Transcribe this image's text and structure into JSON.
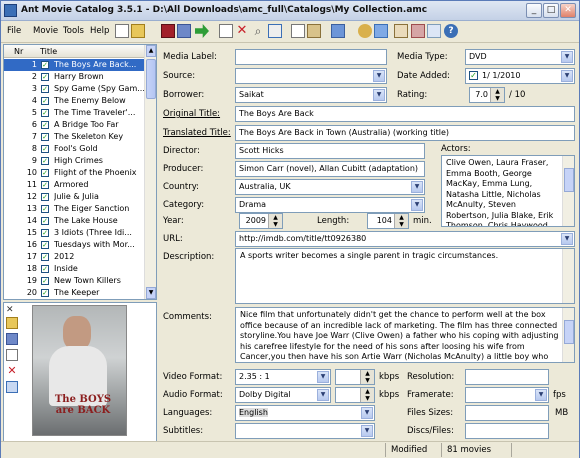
{
  "window": {
    "title": "Ant Movie Catalog 3.5.1 - D:\\All Downloads\\amc_full\\Catalogs\\My Collection.amc"
  },
  "menu": [
    "File",
    "Movie",
    "Tools",
    "Help"
  ],
  "list": {
    "col_nr": "Nr",
    "col_title": "Title",
    "rows": [
      {
        "nr": "1",
        "title": "The Boys Are Back..."
      },
      {
        "nr": "2",
        "title": "Harry Brown"
      },
      {
        "nr": "3",
        "title": "Spy Game (Spy Gam..."
      },
      {
        "nr": "4",
        "title": "The Enemy Below"
      },
      {
        "nr": "5",
        "title": "The Time Traveler'..."
      },
      {
        "nr": "6",
        "title": "A Bridge Too Far"
      },
      {
        "nr": "7",
        "title": "The Skeleton Key"
      },
      {
        "nr": "8",
        "title": "Fool's Gold"
      },
      {
        "nr": "9",
        "title": "High Crimes"
      },
      {
        "nr": "10",
        "title": "Flight of the Phoenix"
      },
      {
        "nr": "11",
        "title": "Armored"
      },
      {
        "nr": "12",
        "title": "Julie & Julia"
      },
      {
        "nr": "13",
        "title": "The Eiger Sanction"
      },
      {
        "nr": "14",
        "title": "The Lake House"
      },
      {
        "nr": "15",
        "title": "3 Idiots (Three Idi..."
      },
      {
        "nr": "16",
        "title": "Tuesdays with Mor..."
      },
      {
        "nr": "17",
        "title": "2012"
      },
      {
        "nr": "18",
        "title": "Inside"
      },
      {
        "nr": "19",
        "title": "New Town Killers"
      },
      {
        "nr": "20",
        "title": "The Keeper"
      }
    ]
  },
  "poster": {
    "text": "The BOYS are BACK"
  },
  "fields": {
    "media_label": {
      "label": "Media Label:",
      "value": ""
    },
    "media_type": {
      "label": "Media Type:",
      "value": "DVD"
    },
    "source": {
      "label": "Source:",
      "value": ""
    },
    "date_added": {
      "label": "Date Added:",
      "value": "1/  1/2010"
    },
    "borrower": {
      "label": "Borrower:",
      "value": "Saikat"
    },
    "rating": {
      "label": "Rating:",
      "value": "7.0",
      "suffix": "/ 10"
    },
    "original_title": {
      "label": "Original Title:",
      "value": "The Boys Are Back"
    },
    "translated_title": {
      "label": "Translated Title:",
      "value": "The Boys Are Back in Town (Australia) (working title)"
    },
    "director": {
      "label": "Director:",
      "value": "Scott Hicks"
    },
    "actors": {
      "label": "Actors:",
      "value": "Clive Owen, Laura Fraser, Emma Booth, George MacKay, Emma Lung, Natasha Little, Nicholas McAnulty, Steven Robertson, Julia Blake, Erik Thomson, Chris Haywood,"
    },
    "producer": {
      "label": "Producer:",
      "value": "Simon Carr (novel), Allan Cubitt (adaptation)"
    },
    "country": {
      "label": "Country:",
      "value": "Australia, UK"
    },
    "category": {
      "label": "Category:",
      "value": "Drama"
    },
    "year": {
      "label": "Year:",
      "value": "2009"
    },
    "length": {
      "label": "Length:",
      "value": "104",
      "suffix": "min."
    },
    "url": {
      "label": "URL:",
      "value": "http://imdb.com/title/tt0926380"
    },
    "description": {
      "label": "Description:",
      "value": "A sports writer becomes a single parent in tragic circumstances."
    },
    "comments": {
      "label": "Comments:",
      "value": "Nice film that unfortunately didn't get the chance to perform well at the box office because of an incredible lack of marketing. The film has three connected storyline.You have Joe Warr (Clive Owen) a father who his coping with adjusting his carefree lifestyle for the need of his sons after loosing his wife from Cancer,you then have his son Artie Warr (Nicholas McAnulty) a little boy who don't know how to handle the loss"
    },
    "video_format": {
      "label": "Video Format:",
      "value": "2.35 : 1",
      "unit": "kbps"
    },
    "audio_format": {
      "label": "Audio Format:",
      "value": "Dolby Digital",
      "unit": "kbps"
    },
    "languages": {
      "label": "Languages:",
      "value": "English"
    },
    "subtitles": {
      "label": "Subtitles:",
      "value": ""
    },
    "resolution": {
      "label": "Resolution:",
      "value": ""
    },
    "framerate": {
      "label": "Framerate:",
      "value": "",
      "unit": "fps"
    },
    "files_sizes": {
      "label": "Files Sizes:",
      "value": "",
      "unit": "MB"
    },
    "discs_files": {
      "label": "Discs/Files:",
      "value": ""
    }
  },
  "status": {
    "modified": "Modified",
    "count": "81 movies"
  },
  "icons": [
    "new-icon",
    "open-icon",
    "save-icon",
    "save-as-icon",
    "exit-icon",
    "add-movie-icon",
    "delete-movie-icon",
    "find-icon",
    "copy-icon",
    "paste-icon",
    "view-icon",
    "script-icon",
    "statistics-icon",
    "help-icon"
  ]
}
